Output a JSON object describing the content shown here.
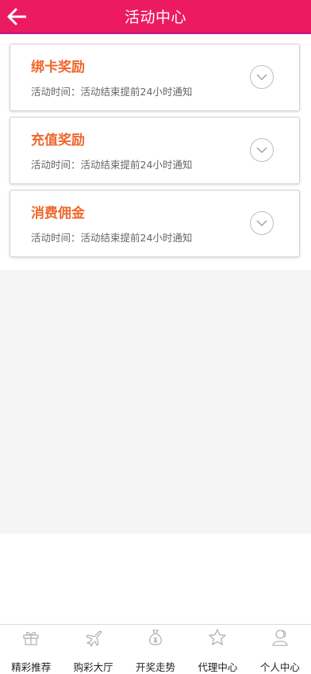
{
  "header": {
    "title": "活动中心",
    "back_icon": "arrow-left-icon",
    "bg_color": "#ec1b61"
  },
  "activities": [
    {
      "title": "绑卡奖励",
      "subtitle": "活动时间：活动结束提前24小时通知"
    },
    {
      "title": "充值奖励",
      "subtitle": "活动时间：活动结束提前24小时通知"
    },
    {
      "title": "消费佣金",
      "subtitle": "活动时间：活动结束提前24小时通知"
    }
  ],
  "tabbar": {
    "items": [
      {
        "label": "精彩推荐",
        "icon": "gift-icon"
      },
      {
        "label": "购彩大厅",
        "icon": "airplane-icon"
      },
      {
        "label": "开奖走势",
        "icon": "money-bag-icon"
      },
      {
        "label": "代理中心",
        "icon": "star-icon"
      },
      {
        "label": "个人中心",
        "icon": "user-icon"
      }
    ]
  },
  "colors": {
    "accent": "#ec1b61",
    "card_title": "#f0662c",
    "icon_grey": "#b5b5b5"
  }
}
